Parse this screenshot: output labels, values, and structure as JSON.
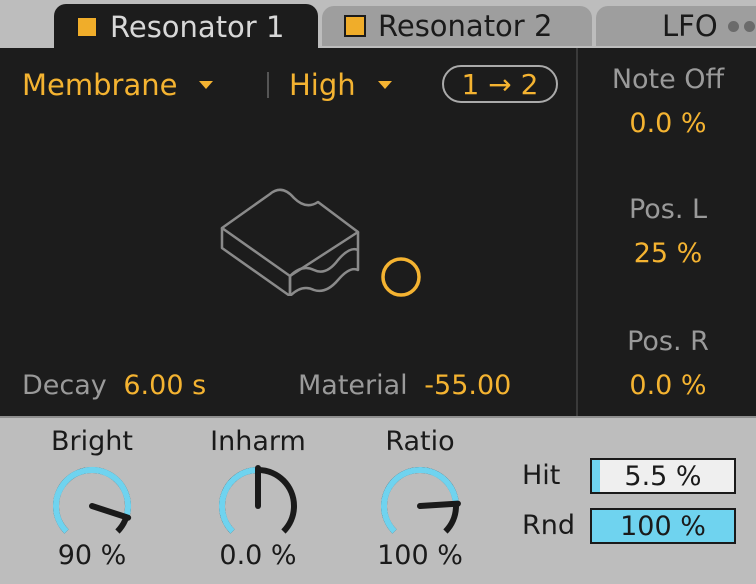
{
  "tabs": [
    {
      "label": "Resonator 1",
      "active": true
    },
    {
      "label": "Resonator 2",
      "active": false
    },
    {
      "label": "LFO",
      "active": false
    }
  ],
  "resonator": {
    "type_value": "Membrane",
    "quality_value": "High",
    "routing_label": "1 → 2",
    "decay": {
      "label": "Decay",
      "value": "6.00 s"
    },
    "material": {
      "label": "Material",
      "value": "-55.00"
    }
  },
  "sidebar": {
    "note_off": {
      "label": "Note Off",
      "value": "0.0 %"
    },
    "pos_l": {
      "label": "Pos. L",
      "value": "25 %"
    },
    "pos_r": {
      "label": "Pos. R",
      "value": "0.0 %"
    }
  },
  "knobs": {
    "bright": {
      "label": "Bright",
      "value": "90 %",
      "level": 0.9
    },
    "inharm": {
      "label": "Inharm",
      "value": "0.0 %",
      "level": 0.5
    },
    "ratio": {
      "label": "Ratio",
      "value": "100 %",
      "level": 0.82
    }
  },
  "fields": {
    "hit": {
      "label": "Hit",
      "value": "5.5 %",
      "level": 0.055
    },
    "rnd": {
      "label": "Rnd",
      "value": "100 %",
      "level": 1.0
    }
  },
  "colors": {
    "accent": "#f4b331",
    "knob_arc": "#6fd3ef",
    "panel": "#1c1c1c"
  }
}
